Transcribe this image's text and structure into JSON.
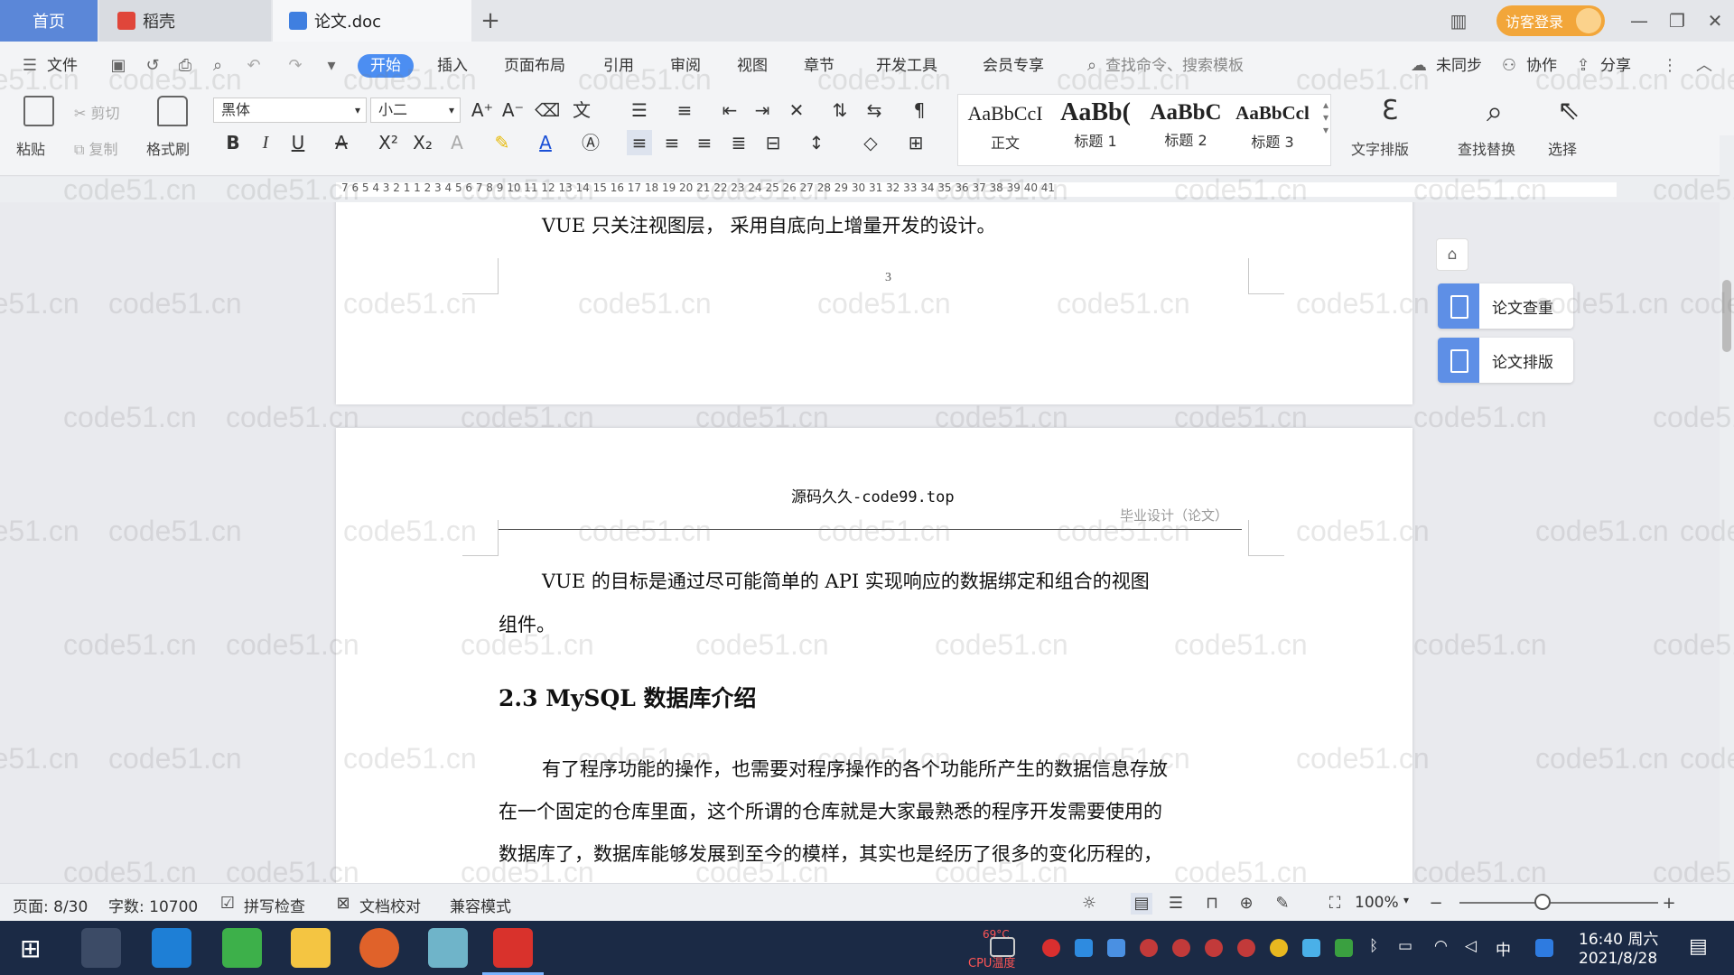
{
  "tabs": {
    "home": "首页",
    "daoke": "稻壳",
    "doc": "论文.doc",
    "add": "+"
  },
  "account": {
    "login": "访客登录"
  },
  "menu": {
    "file": "文件",
    "items": [
      "开始",
      "插入",
      "页面布局",
      "引用",
      "审阅",
      "视图",
      "章节",
      "开发工具",
      "会员专享"
    ],
    "search_placeholder": "查找命令、搜索模板",
    "sync": "未同步",
    "collab": "协作",
    "share": "分享"
  },
  "ribbon": {
    "paste": "粘贴",
    "cut": "剪切",
    "copy": "复制",
    "format_painter": "格式刷",
    "font_name": "黑体",
    "font_size": "小二",
    "styles": [
      {
        "preview": "AaBbCcI",
        "name": "正文"
      },
      {
        "preview": "AaBb(",
        "name": "标题 1"
      },
      {
        "preview": "AaBbC",
        "name": "标题 2"
      },
      {
        "preview": "AaBbCcl",
        "name": "标题 3"
      }
    ],
    "text_layout": "文字排版",
    "find_replace": "查找替换",
    "select": "选择"
  },
  "ruler": {
    "numbers": "7  6  5  4  3  2  1     1  2  3  4  5  6  7  8  9  10  11  12  13  14  15  16  17  18  19  20  21  22  23  24  25  26  27  28  29  30  31  32  33  34  35  36  37  38  39  40  41"
  },
  "document": {
    "page1_line": "VUE 只关注视图层， 采用自底向上增量开发的设计。",
    "page_number": "3",
    "header_center": "源码久久-code99.top",
    "header_right": "毕业设计（论文）",
    "para1_line1": "VUE 的目标是通过尽可能简单的 API 实现响应的数据绑定和组合的视图",
    "para1_line2": "组件。",
    "heading": "2.3 MySQL 数据库介绍",
    "para2_line1": "有了程序功能的操作，也需要对程序操作的各个功能所产生的数据信息存放",
    "para2_line2": "在一个固定的仓库里面，这个所谓的仓库就是大家最熟悉的程序开发需要使用的",
    "para2_line3": "数据库了，数据库能够发展到至今的模样，其实也是经历了很多的变化历程的，"
  },
  "side_panel": {
    "check": "论文查重",
    "layout": "论文排版"
  },
  "status": {
    "page": "页面: 8/30",
    "words": "字数: 10700",
    "spell": "拼写检查",
    "proof": "文档校对",
    "compat": "兼容模式",
    "zoom": "100%",
    "zoom_level": 0.42
  },
  "taskbar": {
    "cpu_temp": "CPU温度",
    "cpu_value": "69°C",
    "ime": "中",
    "time": "16:40 周六",
    "date": "2021/8/28"
  },
  "watermark": "code51.cn",
  "colors": {
    "accent": "#4c8ef2",
    "login": "#f2a63a",
    "home_tab": "#5b87d8",
    "taskbar": "#1b2a45"
  }
}
